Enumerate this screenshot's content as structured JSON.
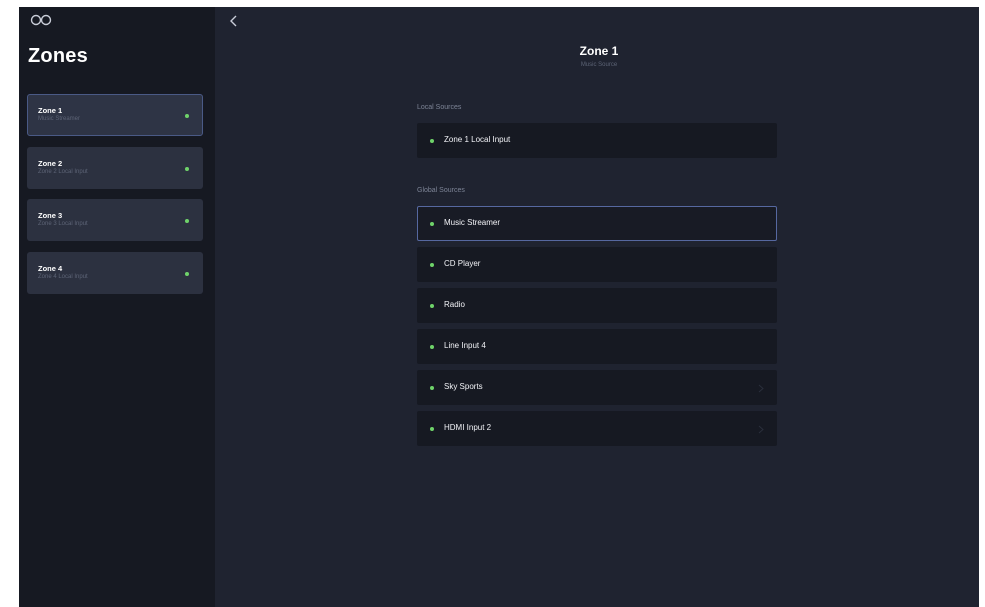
{
  "sidebar": {
    "logo_icon": "infinity-logo-icon",
    "title": "Zones",
    "zones": [
      {
        "name": "Zone 1",
        "source": "Music Streamer",
        "status_color": "#6fd36a",
        "selected": true
      },
      {
        "name": "Zone 2",
        "source": "Zone 2 Local Input",
        "status_color": "#6fd36a",
        "selected": false
      },
      {
        "name": "Zone 3",
        "source": "Zone 3 Local Input",
        "status_color": "#6fd36a",
        "selected": false
      },
      {
        "name": "Zone 4",
        "source": "Zone 4 Local Input",
        "status_color": "#6fd36a",
        "selected": false
      }
    ]
  },
  "header": {
    "back_icon": "chevron-left-icon",
    "title": "Zone 1",
    "subtitle": "Music Source"
  },
  "local_sources": {
    "label": "Local Sources",
    "items": [
      {
        "label": "Zone 1 Local Input",
        "status_color": "#6fd36a"
      }
    ]
  },
  "global_sources": {
    "label": "Global Sources",
    "items": [
      {
        "label": "Music Streamer",
        "status_color": "#6fd36a",
        "selected": true
      },
      {
        "label": "CD Player",
        "status_color": "#6fd36a"
      },
      {
        "label": "Radio",
        "status_color": "#6fd36a"
      },
      {
        "label": "Line Input 4",
        "status_color": "#6fd36a"
      },
      {
        "label": "Sky Sports",
        "status_color": "#6fd36a",
        "chevron": "chevron-right-icon"
      },
      {
        "label": "HDMI Input 2",
        "status_color": "#6fd36a",
        "chevron": "chevron-right-icon"
      }
    ]
  },
  "colors": {
    "app_background": "#1f2330",
    "sidebar_background": "#161922",
    "card_background": "#2c3140",
    "selected_border": "#5668a0",
    "status_green": "#6fd36a"
  }
}
